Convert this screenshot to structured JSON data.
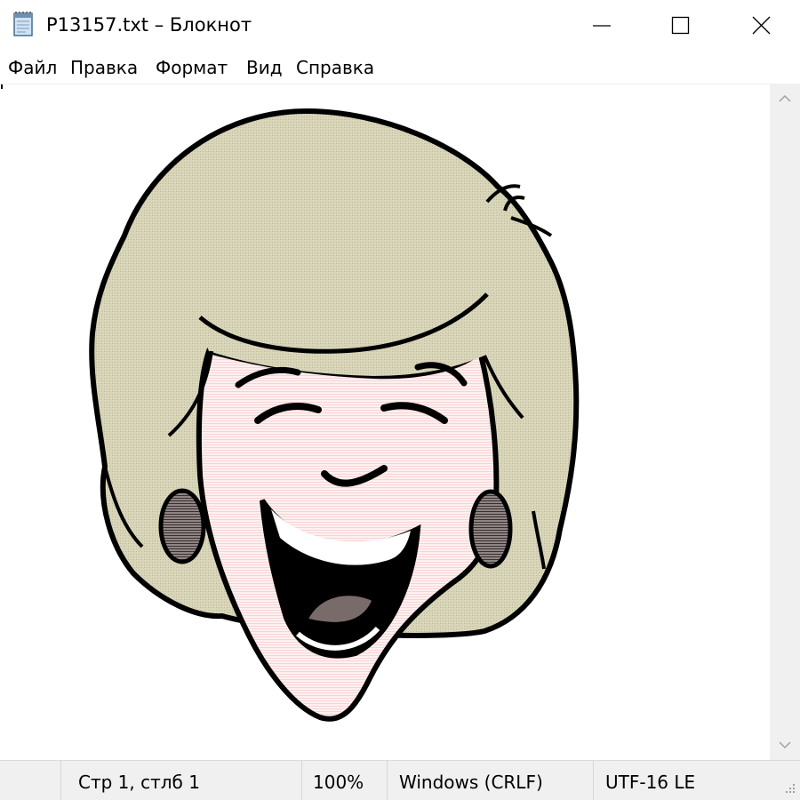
{
  "window": {
    "title": "P13157.txt – Блокнот",
    "app_icon": "notepad-icon"
  },
  "title_buttons": {
    "minimize_icon": "minimize-icon",
    "maximize_icon": "maximize-icon",
    "close_icon": "close-icon"
  },
  "menu": {
    "items": [
      {
        "label": "Файл"
      },
      {
        "label": "Правка"
      },
      {
        "label": "Формат"
      },
      {
        "label": "Вид"
      },
      {
        "label": "Справка"
      }
    ]
  },
  "editor": {
    "content": "laughing-woman-ascii-art",
    "colors": {
      "hair": "#d8d5b9",
      "skin": "#fbe3e3",
      "outline": "#000000",
      "earring": "#6b6262",
      "mouth_inner": "#000000",
      "teeth": "#ffffff",
      "tongue": "#7a6b6b"
    }
  },
  "scrollbar": {
    "up_icon": "scroll-up-arrow-icon",
    "down_icon": "scroll-down-arrow-icon"
  },
  "status": {
    "position": "Стр 1, стлб 1",
    "zoom": "100%",
    "line_endings": "Windows (CRLF)",
    "encoding": "UTF-16 LE",
    "grip_icon": "resize-grip-icon"
  }
}
